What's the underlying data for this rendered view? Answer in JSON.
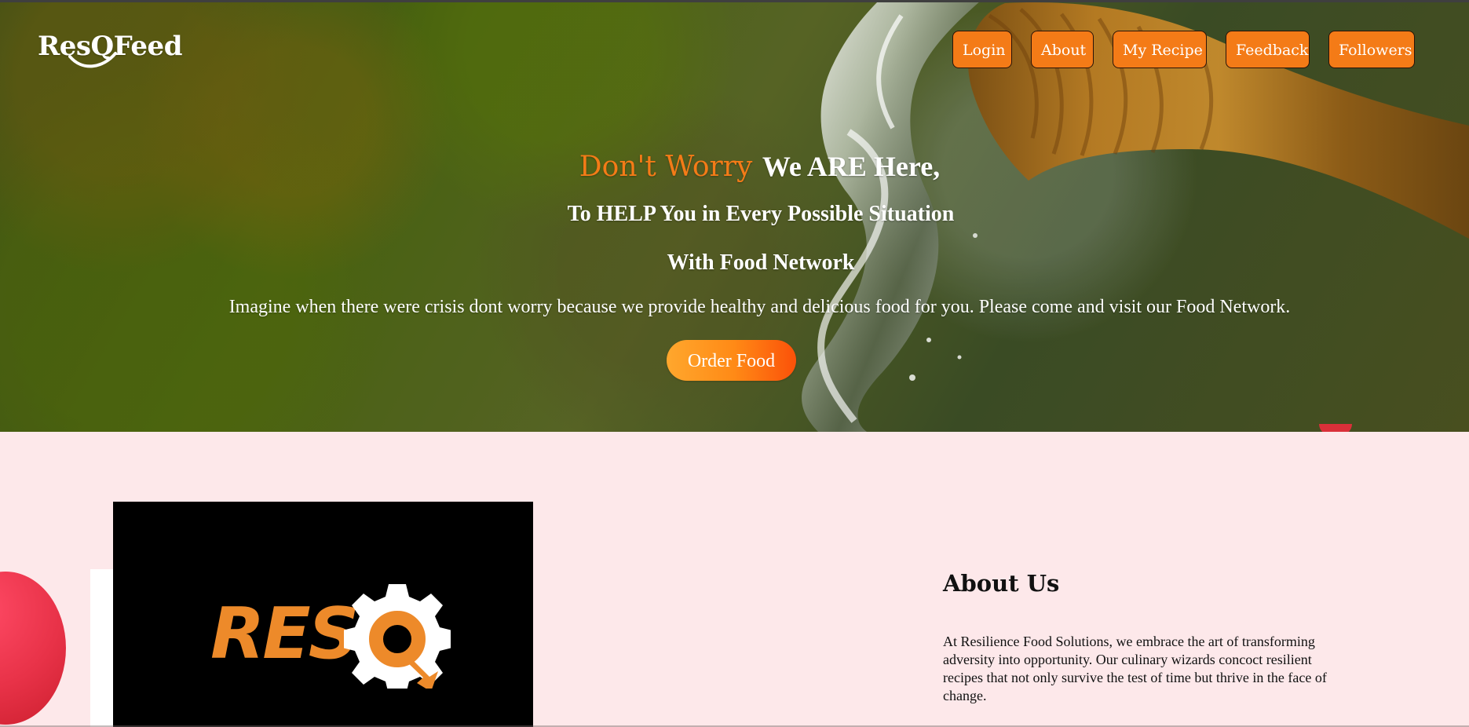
{
  "brand": {
    "name": "ResQFeed"
  },
  "nav": {
    "items": [
      {
        "label": "Login"
      },
      {
        "label": "About"
      },
      {
        "label": "My Recipe"
      },
      {
        "label": "Feedback"
      },
      {
        "label": "Followers"
      }
    ]
  },
  "hero": {
    "headline_accent": "Don't Worry",
    "headline_rest": "We ARE Here,",
    "subhead_one": "To HELP You in Every Possible Situation",
    "subhead_two": "With Food Network",
    "body": "Imagine when there were crisis dont worry because we provide healthy and delicious food for you. Please come and visit our Food Network.",
    "order_button": "Order Food"
  },
  "about": {
    "image_text": "RES Q",
    "title": "About Us",
    "body": "At Resilience Food Solutions, we embrace the art of transforming adversity into opportunity. Our culinary wizards concoct resilient recipes that not only survive the test of time but thrive in the face of change."
  },
  "colors": {
    "accent": "#f47b17",
    "background": "#fde8ea",
    "red_circle": "#e83248"
  },
  "icons": {
    "gear": "gear-icon",
    "red_circle": "circle-decoration"
  }
}
